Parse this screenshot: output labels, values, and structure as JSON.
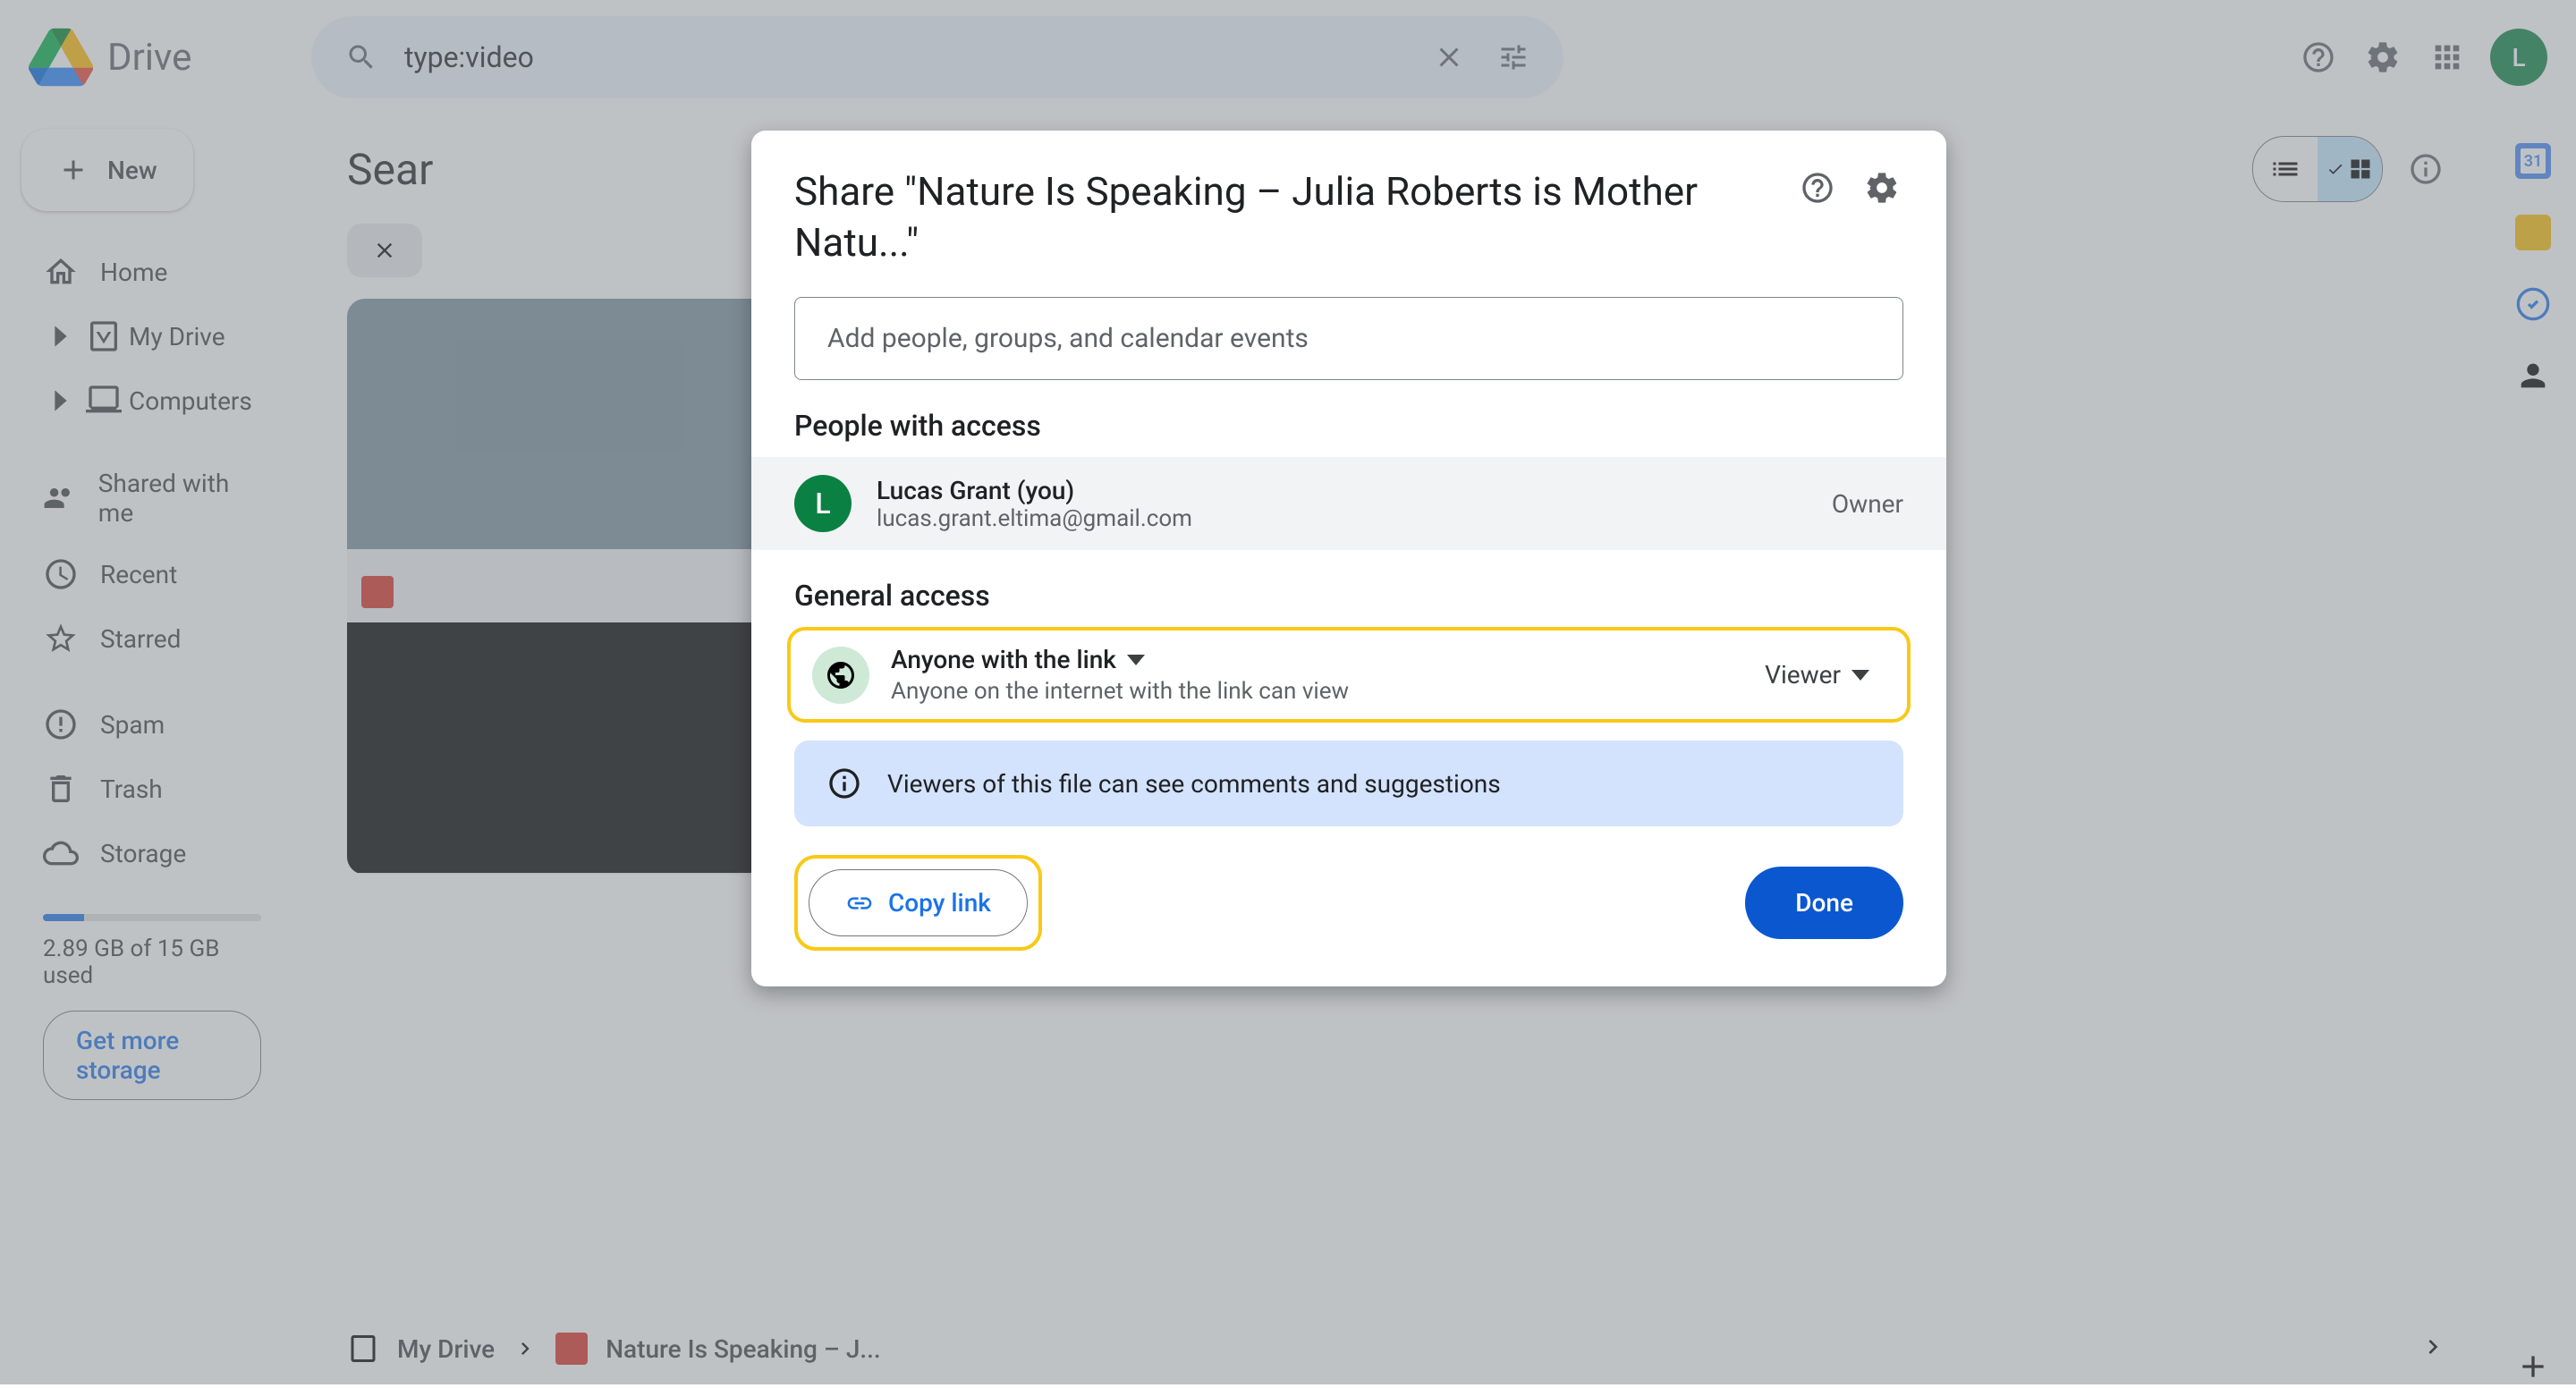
{
  "app": {
    "name": "Drive"
  },
  "search": {
    "value": "type:video"
  },
  "header_avatar": "L",
  "sidebar": {
    "new_label": "New",
    "items": [
      {
        "label": "Home"
      },
      {
        "label": "My Drive"
      },
      {
        "label": "Computers"
      },
      {
        "label": "Shared with me"
      },
      {
        "label": "Recent"
      },
      {
        "label": "Starred"
      },
      {
        "label": "Spam"
      },
      {
        "label": "Trash"
      },
      {
        "label": "Storage"
      }
    ],
    "storage_used": "2.89 GB of 15 GB used",
    "storage_cta": "Get more storage"
  },
  "content": {
    "title": "Sear"
  },
  "breadcrumb": {
    "root": "My Drive",
    "current": "Nature Is Speaking – J..."
  },
  "modal": {
    "title": "Share \"Nature Is Speaking – Julia Roberts is Mother Natu...\"",
    "add_placeholder": "Add people, groups, and calendar events",
    "people_section": "People with access",
    "owner": {
      "initial": "L",
      "name": "Lucas Grant (you)",
      "email": "lucas.grant.eltima@gmail.com",
      "role": "Owner"
    },
    "general_section": "General access",
    "access": {
      "mode": "Anyone with the link",
      "desc": "Anyone on the internet with the link can view",
      "role": "Viewer"
    },
    "banner": "Viewers of this file can see comments and suggestions",
    "copy_link": "Copy link",
    "done": "Done"
  }
}
